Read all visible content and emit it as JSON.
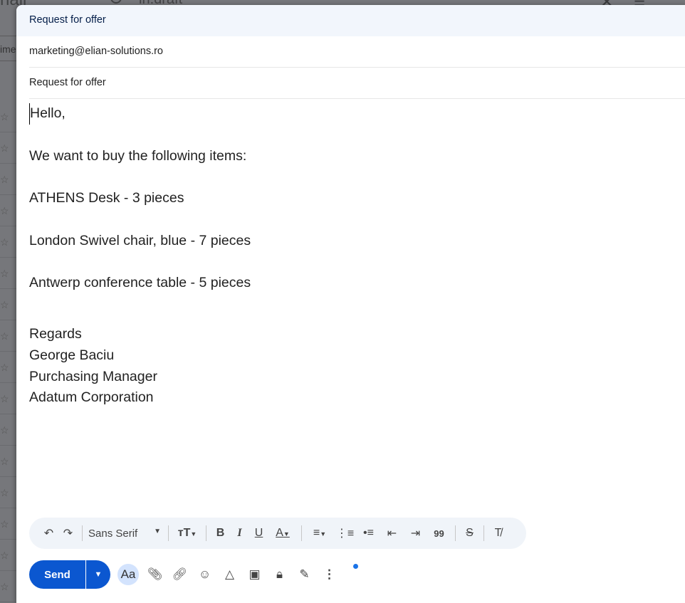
{
  "background": {
    "app_title": "nail",
    "search_query": "in:draft",
    "tab_partial": "ime"
  },
  "compose": {
    "window_title": "Request for offer",
    "to": "marketing@elian-solutions.ro",
    "subject": "Request for offer",
    "body_lines": [
      "Hello,",
      "",
      "We want to buy the following items:",
      "",
      "ATHENS Desk - 3 pieces",
      "",
      "London Swivel chair, blue - 7 pieces",
      "",
      "Antwerp conference table -  5 pieces",
      "",
      ""
    ],
    "signature_lines": [
      "Regards",
      "George Baciu",
      "Purchasing Manager",
      "Adatum Corporation"
    ]
  },
  "format_toolbar": {
    "font": "Sans Serif"
  },
  "bottom_bar": {
    "send_label": "Send",
    "formatting_label": "Aa"
  },
  "colors": {
    "accent": "#0b57d0",
    "header_bg": "#f2f6fc"
  }
}
